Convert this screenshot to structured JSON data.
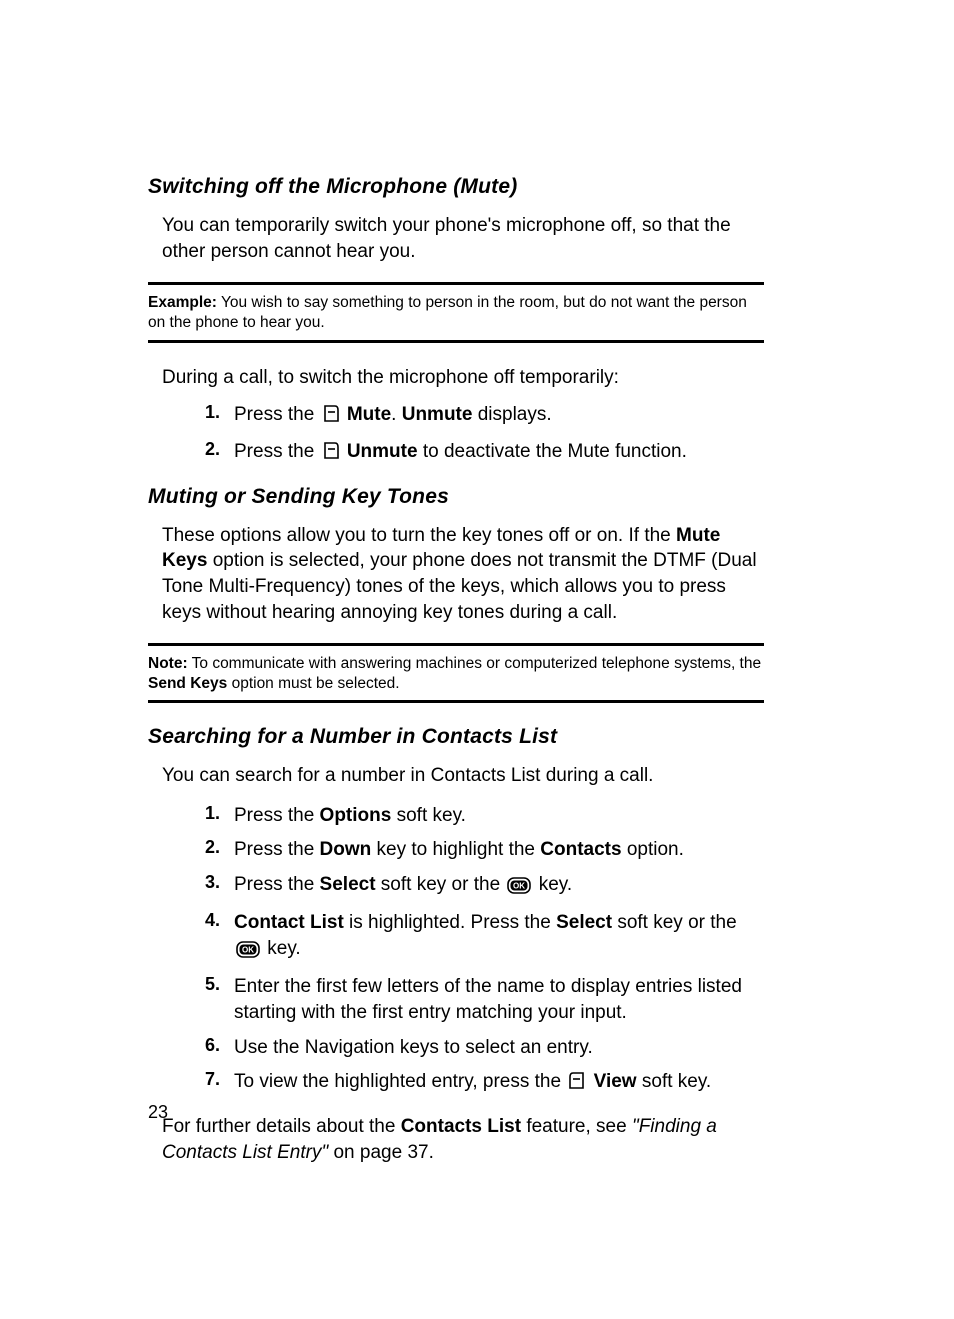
{
  "page_number": "23",
  "section1": {
    "heading": "Switching off the Microphone (Mute)",
    "para": "You can temporarily switch your phone's microphone off, so that the other person cannot hear you.",
    "example_label": "Example:",
    "example_text": " You wish to say something to person in the room, but do not want the person on the phone to hear you.",
    "intro": "During a call, to switch the microphone off temporarily:",
    "step1_num": "1.",
    "step1_a": "Press the ",
    "step1_b": "Mute",
    "step1_c": ". ",
    "step1_d": "Unmute",
    "step1_e": " displays.",
    "step2_num": "2.",
    "step2_a": "Press the ",
    "step2_b": "Unmute",
    "step2_c": " to deactivate the Mute function."
  },
  "section2": {
    "heading": "Muting or Sending Key Tones",
    "para_a": "These options allow you to turn the key tones off or on. If the ",
    "para_b": "Mute Keys",
    "para_c": " option is selected, your phone does not transmit the DTMF (Dual Tone Multi-Frequency) tones of the keys, which allows you to press keys without hearing annoying key tones during a call.",
    "note_label": "Note:",
    "note_a": " To communicate with answering machines or computerized telephone systems, the ",
    "note_b": "Send Keys",
    "note_c": " option must be selected."
  },
  "section3": {
    "heading": "Searching for a Number in Contacts List",
    "para": "You can search for a number in Contacts List during a call.",
    "s1_num": "1.",
    "s1_a": "Press the ",
    "s1_b": "Options",
    "s1_c": " soft key.",
    "s2_num": "2.",
    "s2_a": "Press the ",
    "s2_b": "Down",
    "s2_c": " key to highlight the ",
    "s2_d": "Contacts",
    "s2_e": " option.",
    "s3_num": "3.",
    "s3_a": "Press the ",
    "s3_b": "Select",
    "s3_c": " soft key or the ",
    "s3_d": " key.",
    "s4_num": "4.",
    "s4_a": "Contact List",
    "s4_b": " is highlighted. Press the ",
    "s4_c": "Select",
    "s4_d": " soft key or the ",
    "s4_e": " key.",
    "s5_num": "5.",
    "s5_a": "Enter the first few letters of the name to display entries listed starting with the first entry matching your input.",
    "s6_num": "6.",
    "s6_a": "Use the Navigation keys to select an entry.",
    "s7_num": "7.",
    "s7_a": "To view the highlighted entry, press the ",
    "s7_b": "View",
    "s7_c": " soft key.",
    "closing_a": "For further details about the ",
    "closing_b": "Contacts List",
    "closing_c": " feature, see ",
    "closing_d": "\"Finding a Contacts List Entry\"",
    "closing_e": "  on page 37."
  }
}
